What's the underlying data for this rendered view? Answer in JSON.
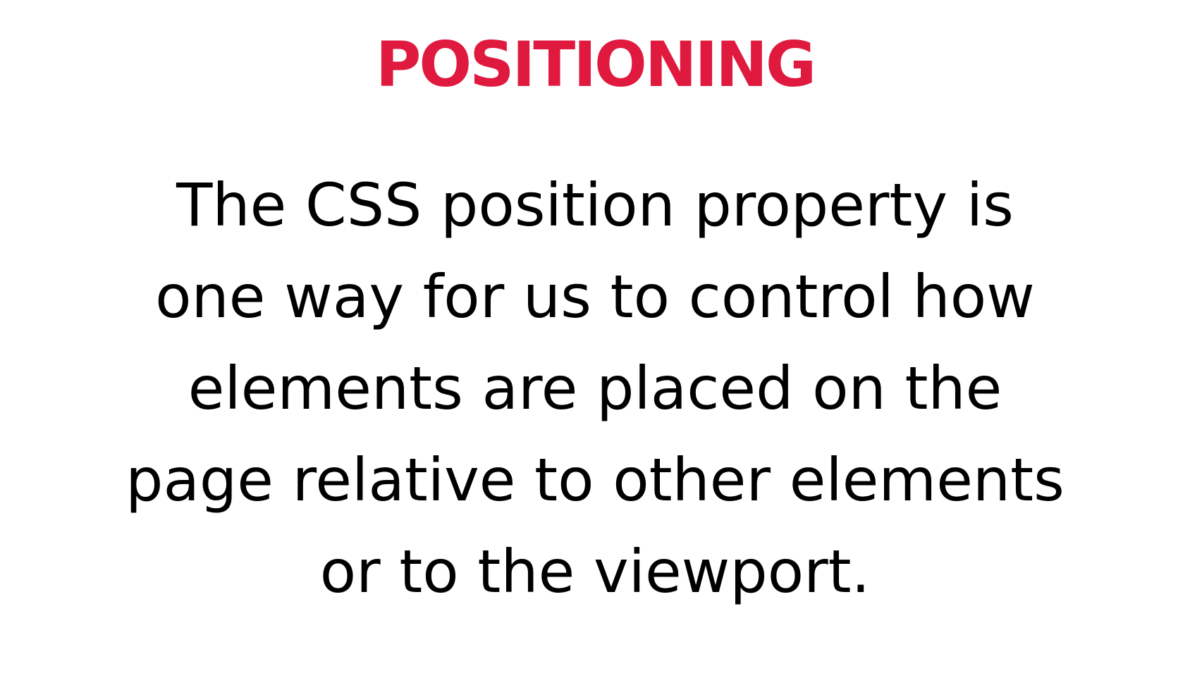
{
  "slide": {
    "title": "POSITIONING",
    "body_lines": [
      "The CSS position property is",
      "one way for us to control how",
      "elements are placed on the",
      "page relative to other elements",
      "or to the viewport."
    ]
  },
  "colors": {
    "title": "#e0193e",
    "text": "#000000",
    "background": "#ffffff"
  }
}
